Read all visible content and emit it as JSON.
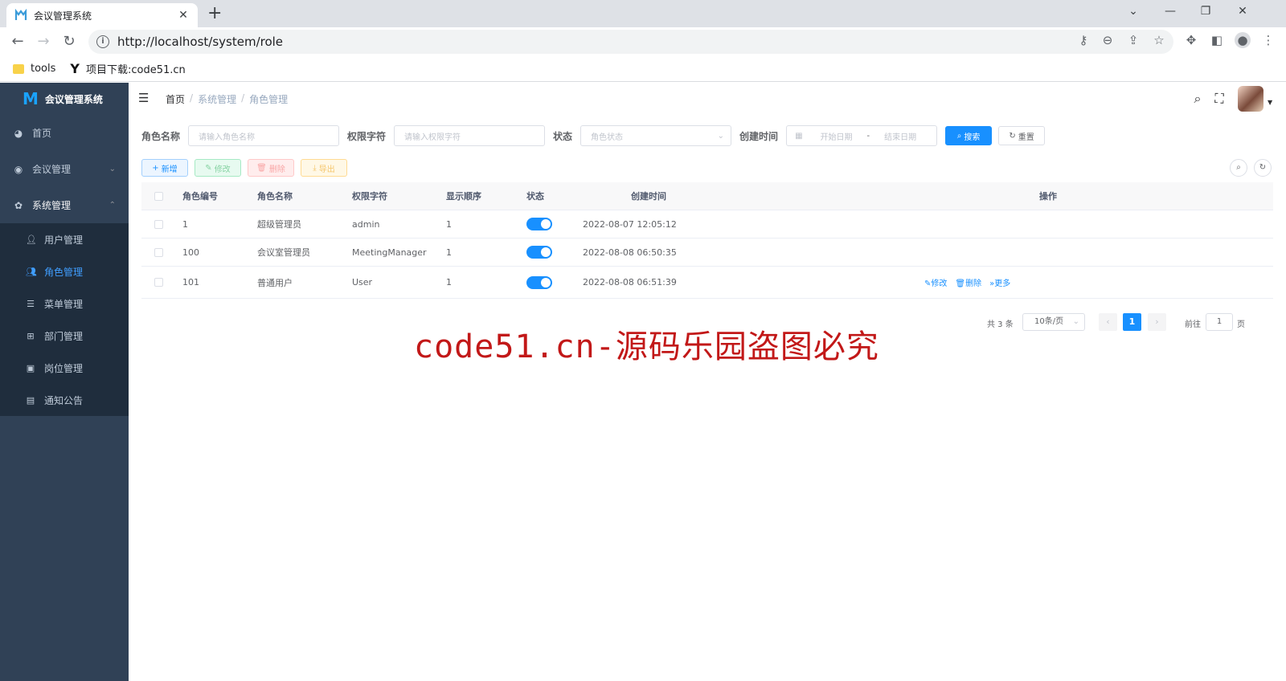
{
  "browser": {
    "tab_title": "会议管理系统",
    "url": "http://localhost/system/role",
    "bookmarks": [
      {
        "label": "tools"
      },
      {
        "label": "项目下载:code51.cn"
      }
    ]
  },
  "sidebar": {
    "app_title": "会议管理系统",
    "items": [
      {
        "label": "首页",
        "icon": "dashboard-icon"
      },
      {
        "label": "会议管理",
        "icon": "globe-icon"
      },
      {
        "label": "系统管理",
        "icon": "gear-icon"
      }
    ],
    "subitems": [
      {
        "label": "用户管理",
        "icon": "user-icon"
      },
      {
        "label": "角色管理",
        "icon": "peoples-icon"
      },
      {
        "label": "菜单管理",
        "icon": "tree-table-icon"
      },
      {
        "label": "部门管理",
        "icon": "tree-icon"
      },
      {
        "label": "岗位管理",
        "icon": "post-icon"
      },
      {
        "label": "通知公告",
        "icon": "message-icon"
      }
    ]
  },
  "navbar": {
    "breadcrumb": [
      "首页",
      "系统管理",
      "角色管理"
    ]
  },
  "search": {
    "role_name_label": "角色名称",
    "role_name_placeholder": "请输入角色名称",
    "role_key_label": "权限字符",
    "role_key_placeholder": "请输入权限字符",
    "status_label": "状态",
    "status_placeholder": "角色状态",
    "created_label": "创建时间",
    "start_placeholder": "开始日期",
    "date_sep": "-",
    "end_placeholder": "结束日期",
    "search_button": "搜索",
    "reset_button": "重置"
  },
  "actions": {
    "add": "新增",
    "edit": "修改",
    "delete": "删除",
    "export": "导出"
  },
  "table": {
    "headers": [
      "角色编号",
      "角色名称",
      "权限字符",
      "显示顺序",
      "状态",
      "创建时间",
      "操作"
    ],
    "rows": [
      {
        "id": "1",
        "name": "超级管理员",
        "key": "admin",
        "sort": "1",
        "enabled": true,
        "created": "2022-08-07 12:05:12"
      },
      {
        "id": "100",
        "name": "会议室管理员",
        "key": "MeetingManager",
        "sort": "1",
        "enabled": true,
        "created": "2022-08-08 06:50:35"
      },
      {
        "id": "101",
        "name": "普通用户",
        "key": "User",
        "sort": "1",
        "enabled": true,
        "created": "2022-08-08 06:51:39"
      }
    ],
    "row_ops": {
      "edit": "修改",
      "delete": "删除",
      "more": "更多"
    }
  },
  "pagination": {
    "total": "共 3 条",
    "page_size": "10条/页",
    "current_page": "1",
    "goto_label": "前往",
    "goto_value": "1",
    "page_suffix": "页"
  },
  "watermark": "code51.cn-源码乐园盗图必究",
  "colors": {
    "sidebar_bg": "#304156",
    "submenu_bg": "#1f2d3d",
    "primary": "#1890ff",
    "watermark": "#c21818"
  }
}
